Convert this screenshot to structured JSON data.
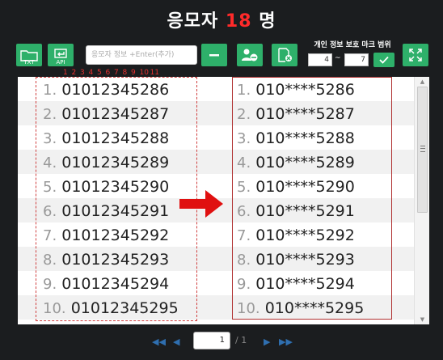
{
  "header": {
    "title_prefix": "응모자",
    "count": "18",
    "title_suffix": "명"
  },
  "toolbar": {
    "txt_label": "TXT",
    "api_label": "API",
    "search_placeholder": "응모자 정보 +Enter(추가)",
    "privacy_label": "개인 정보 보호 마크 범위",
    "range_start": "4",
    "range_tilde": "~",
    "range_end": "7"
  },
  "ruler": [
    "1",
    "2",
    "3",
    "4",
    "5",
    "6",
    "7",
    "8",
    "9",
    "10",
    "11"
  ],
  "entries_left": [
    {
      "num": "1.",
      "value": "01012345286"
    },
    {
      "num": "2.",
      "value": "01012345287"
    },
    {
      "num": "3.",
      "value": "01012345288"
    },
    {
      "num": "4.",
      "value": "01012345289"
    },
    {
      "num": "5.",
      "value": "01012345290"
    },
    {
      "num": "6.",
      "value": "01012345291"
    },
    {
      "num": "7.",
      "value": "01012345292"
    },
    {
      "num": "8.",
      "value": "01012345293"
    },
    {
      "num": "9.",
      "value": "01012345294"
    },
    {
      "num": "10.",
      "value": "01012345295"
    }
  ],
  "entries_right": [
    {
      "num": "1.",
      "value": "010****5286"
    },
    {
      "num": "2.",
      "value": "010****5287"
    },
    {
      "num": "3.",
      "value": "010****5288"
    },
    {
      "num": "4.",
      "value": "010****5289"
    },
    {
      "num": "5.",
      "value": "010****5290"
    },
    {
      "num": "6.",
      "value": "010****5291"
    },
    {
      "num": "7.",
      "value": "010****5292"
    },
    {
      "num": "8.",
      "value": "010****5293"
    },
    {
      "num": "9.",
      "value": "010****5294"
    },
    {
      "num": "10.",
      "value": "010****5295"
    }
  ],
  "pager": {
    "current_page": "1",
    "total": "/ 1"
  },
  "colors": {
    "accent_green": "#2eb06a",
    "count_red": "#ff2a2a",
    "arrow_red": "#e01010",
    "pager_blue": "#2f6fb0"
  }
}
